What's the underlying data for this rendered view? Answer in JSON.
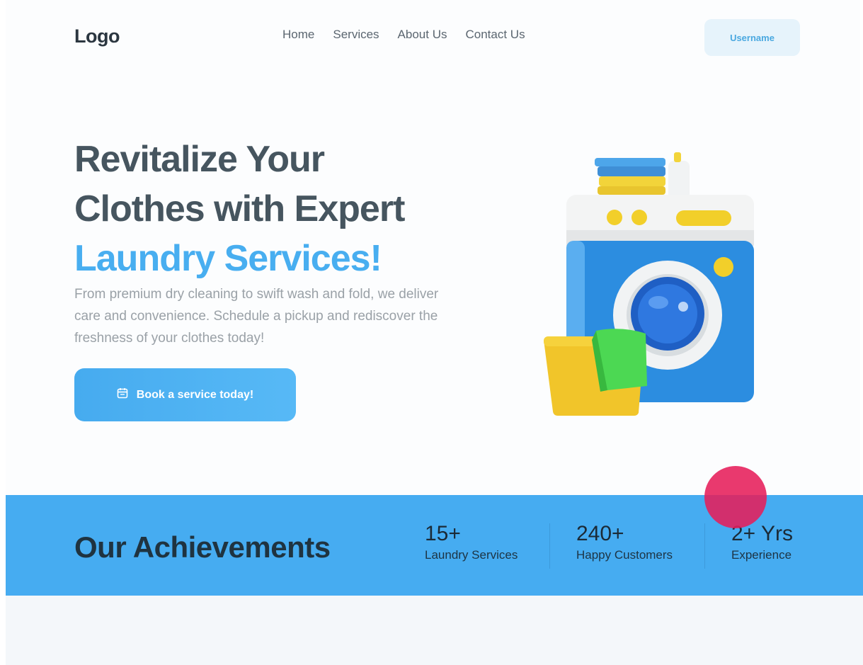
{
  "header": {
    "logo": "Logo",
    "nav": [
      "Home",
      "Services",
      "About Us",
      "Contact Us"
    ],
    "user_button": "Username"
  },
  "hero": {
    "title_line1": "Revitalize Your",
    "title_line2": "Clothes with Expert",
    "title_accent": "Laundry Services!",
    "description": "From premium dry cleaning to swift wash and fold, we deliver care and convenience. Schedule a pickup and rediscover the freshness of your clothes today!",
    "cta_label": "Book a service today!",
    "cta_icon": "calendar-icon",
    "illustration": "washing-machine-illustration"
  },
  "achievements": {
    "title": "Our Achievements",
    "stats": [
      {
        "value": "15+",
        "label": "Laundry Services"
      },
      {
        "value": "240+",
        "label": "Happy Customers"
      },
      {
        "value": "2+ Yrs",
        "label": "Experience"
      }
    ]
  },
  "colors": {
    "accent": "#48aef0",
    "band": "#46acf1",
    "title": "#46555f",
    "cursor_dot": "#e61e5a"
  }
}
